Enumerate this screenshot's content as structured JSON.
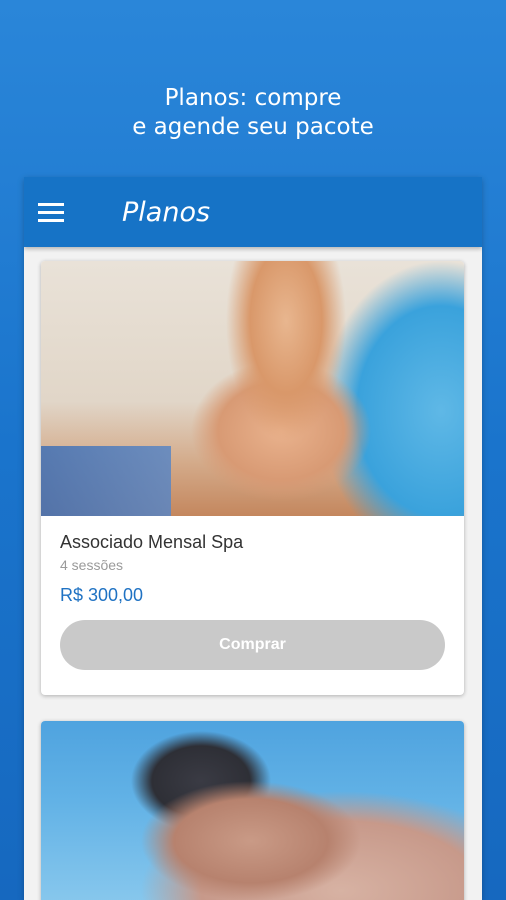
{
  "promo": {
    "line1": "Planos: compre",
    "line2": "e agende seu pacote"
  },
  "app_bar": {
    "menu_icon": "hamburger-menu-icon",
    "title": "Planos"
  },
  "plans": [
    {
      "name": "Associado Mensal Spa",
      "sessions": "4 sessões",
      "price": "R$ 300,00",
      "buy_label": "Comprar",
      "buy_enabled": false
    }
  ],
  "colors": {
    "background": "#1a74cc",
    "app_bar": "#1673c6",
    "price": "#1f72c3",
    "buy_button_disabled": "#c9c9c9"
  }
}
